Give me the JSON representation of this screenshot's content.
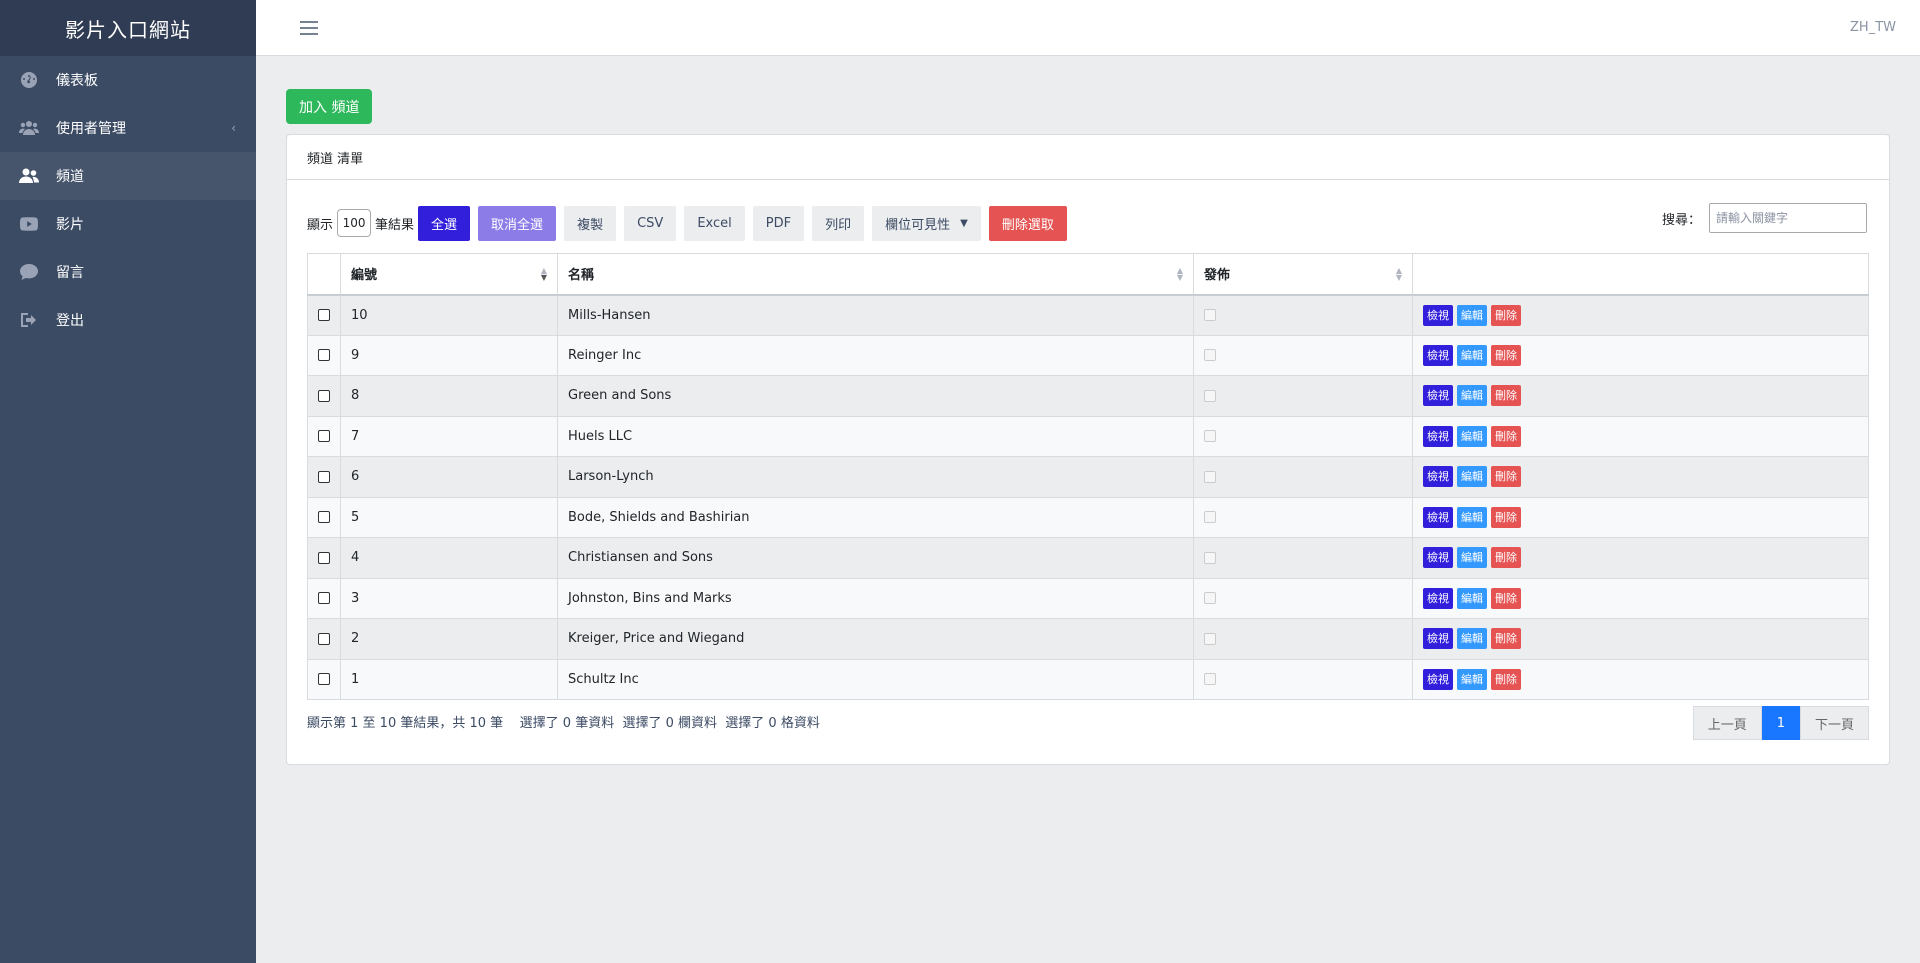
{
  "sidebar": {
    "brand": "影片入口網站",
    "items": [
      {
        "label": "儀表板",
        "icon": "speedometer-icon"
      },
      {
        "label": "使用者管理",
        "icon": "users-icon",
        "caret": "‹"
      },
      {
        "label": "頻道",
        "icon": "user-group-icon",
        "active": true
      },
      {
        "label": "影片",
        "icon": "youtube-icon"
      },
      {
        "label": "留言",
        "icon": "comment-icon"
      },
      {
        "label": "登出",
        "icon": "logout-icon"
      }
    ]
  },
  "header": {
    "menu_icon": "hamburger-icon",
    "locale": "ZH_TW"
  },
  "main": {
    "add_button": "加入 頻道",
    "card_title": "頻道 清單",
    "toolbar": {
      "show_label": "顯示",
      "page_length": "100",
      "results_label": "筆結果",
      "select_all": "全選",
      "deselect_all": "取消全選",
      "copy": "複製",
      "csv": "CSV",
      "excel": "Excel",
      "pdf": "PDF",
      "print": "列印",
      "column_visibility": "欄位可見性",
      "delete_selected": "刪除選取"
    },
    "search": {
      "label": "搜尋：",
      "placeholder": "請輸入關鍵字"
    },
    "table": {
      "columns": [
        "",
        "編號",
        "名稱",
        "發佈",
        ""
      ],
      "rows": [
        {
          "id": "10",
          "name": "Mills-Hansen"
        },
        {
          "id": "9",
          "name": "Reinger Inc"
        },
        {
          "id": "8",
          "name": "Green and Sons"
        },
        {
          "id": "7",
          "name": "Huels LLC"
        },
        {
          "id": "6",
          "name": "Larson-Lynch"
        },
        {
          "id": "5",
          "name": "Bode, Shields and Bashirian"
        },
        {
          "id": "4",
          "name": "Christiansen and Sons"
        },
        {
          "id": "3",
          "name": "Johnston, Bins and Marks"
        },
        {
          "id": "2",
          "name": "Kreiger, Price and Wiegand"
        },
        {
          "id": "1",
          "name": "Schultz Inc"
        }
      ],
      "actions": {
        "view": "檢視",
        "edit": "編輯",
        "delete": "刪除"
      }
    },
    "info": "顯示第 1 至 10 筆結果，共 10 筆    選擇了 0 筆資料  選擇了 0 欄資料  選擇了 0 格資料",
    "pagination": {
      "prev": "上一頁",
      "current": "1",
      "next": "下一頁"
    }
  },
  "colors": {
    "sidebar_bg": "#3c4b64",
    "primary": "#321fdb",
    "success": "#2eb85c",
    "danger": "#e55353",
    "info": "#39f"
  }
}
